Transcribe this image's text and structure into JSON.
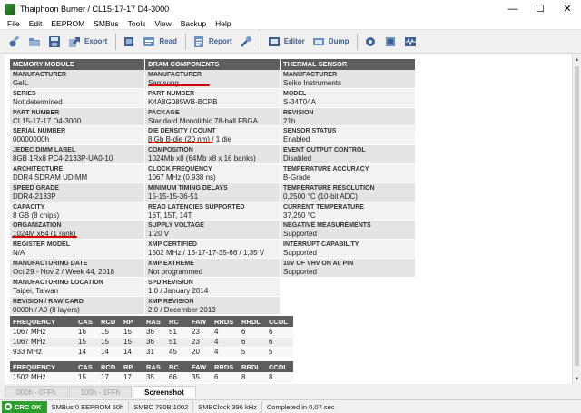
{
  "window": {
    "title": "Thaiphoon Burner / CL15-17-17 D4-3000",
    "controls": [
      "—",
      "☐",
      "✕"
    ]
  },
  "menu": [
    "File",
    "Edit",
    "EEPROM",
    "SMBus",
    "Tools",
    "View",
    "Backup",
    "Help"
  ],
  "toolbar": {
    "export_label": "Export",
    "read_label": "Read",
    "report_label": "Report",
    "editor_label": "Editor",
    "dump_label": "Dump"
  },
  "memory_module": {
    "header": "MEMORY MODULE",
    "rows": [
      {
        "label": "MANUFACTURER",
        "value": "GeIL"
      },
      {
        "label": "SERIES",
        "value": "Not determined"
      },
      {
        "label": "PART NUMBER",
        "value": "CL15-17-17 D4-3000"
      },
      {
        "label": "SERIAL NUMBER",
        "value": "00000000h"
      },
      {
        "label": "JEDEC DIMM LABEL",
        "value": "8GB 1Rx8 PC4-2133P-UA0-10"
      },
      {
        "label": "ARCHITECTURE",
        "value": "DDR4 SDRAM UDIMM"
      },
      {
        "label": "SPEED GRADE",
        "value": "DDR4-2133P"
      },
      {
        "label": "CAPACITY",
        "value": "8 GB (8 chips)"
      },
      {
        "label": "ORGANIZATION",
        "value": "1024M x64 (1 rank)"
      },
      {
        "label": "REGISTER MODEL",
        "value": "N/A"
      },
      {
        "label": "MANUFACTURING DATE",
        "value": "Oct 29 - Nov 2 / Week 44, 2018"
      },
      {
        "label": "MANUFACTURING LOCATION",
        "value": "Taipei, Taiwan"
      },
      {
        "label": "REVISION / RAW CARD",
        "value": "0000h / A0 (8 layers)"
      }
    ]
  },
  "dram_components": {
    "header": "DRAM COMPONENTS",
    "rows": [
      {
        "label": "MANUFACTURER",
        "value": "Samsung"
      },
      {
        "label": "PART NUMBER",
        "value": "K4A8G085WB-BCPB"
      },
      {
        "label": "PACKAGE",
        "value": "Standard Monolithic 78-ball FBGA"
      },
      {
        "label": "DIE DENSITY / COUNT",
        "value": "8 Gb B-die (20 nm) / 1 die"
      },
      {
        "label": "COMPOSITION",
        "value": "1024Mb x8 (64Mb x8 x 16 banks)"
      },
      {
        "label": "CLOCK FREQUENCY",
        "value": "1067 MHz (0.938 ns)"
      },
      {
        "label": "MINIMUM TIMING DELAYS",
        "value": "15-15-15-36-51"
      },
      {
        "label": "READ LATENCIES SUPPORTED",
        "value": "16T, 15T, 14T"
      },
      {
        "label": "SUPPLY VOLTAGE",
        "value": "1,20 V"
      },
      {
        "label": "XMP CERTIFIED",
        "value": "1502 MHz / 15-17-17-35-66 / 1,35 V"
      },
      {
        "label": "XMP EXTREME",
        "value": "Not programmed"
      },
      {
        "label": "SPD REVISION",
        "value": "1.0 / January 2014"
      },
      {
        "label": "XMP REVISION",
        "value": "2.0 / December 2013"
      }
    ]
  },
  "thermal_sensor": {
    "header": "THERMAL SENSOR",
    "rows": [
      {
        "label": "MANUFACTURER",
        "value": "Seiko Instruments"
      },
      {
        "label": "MODEL",
        "value": "S-34T04A"
      },
      {
        "label": "REVISION",
        "value": "21h"
      },
      {
        "label": "SENSOR STATUS",
        "value": "Enabled"
      },
      {
        "label": "EVENT OUTPUT CONTROL",
        "value": "Disabled"
      },
      {
        "label": "TEMPERATURE ACCURACY",
        "value": "B-Grade"
      },
      {
        "label": "TEMPERATURE RESOLUTION",
        "value": "0,2500 °C (10-bit ADC)"
      },
      {
        "label": "CURRENT TEMPERATURE",
        "value": "37,250 °C"
      },
      {
        "label": "NEGATIVE MEASUREMENTS",
        "value": "Supported"
      },
      {
        "label": "INTERRUPT CAPABILITY",
        "value": "Supported"
      },
      {
        "label": "10V OF VHV ON A0 PIN",
        "value": "Supported"
      }
    ]
  },
  "timing_table": {
    "headers": [
      "FREQUENCY",
      "CAS",
      "RCD",
      "RP",
      "RAS",
      "RC",
      "FAW",
      "RRDS",
      "RRDL",
      "CCDL"
    ],
    "rows": [
      [
        "1067 MHz",
        "16",
        "15",
        "15",
        "36",
        "51",
        "23",
        "4",
        "6",
        "6"
      ],
      [
        "1067 MHz",
        "15",
        "15",
        "15",
        "36",
        "51",
        "23",
        "4",
        "6",
        "6"
      ],
      [
        "933 MHz",
        "14",
        "14",
        "14",
        "31",
        "45",
        "20",
        "4",
        "5",
        "5"
      ]
    ]
  },
  "xmp_table": {
    "headers": [
      "FREQUENCY",
      "CAS",
      "RCD",
      "RP",
      "RAS",
      "RC",
      "FAW",
      "RRDS",
      "RRDL",
      "CCDL"
    ],
    "rows": [
      [
        "1502 MHz",
        "15",
        "17",
        "17",
        "35",
        "66",
        "35",
        "6",
        "8",
        "8"
      ]
    ]
  },
  "tabs": [
    "000h - 0FFh",
    "100h - 1FFh",
    "Screenshot"
  ],
  "status": {
    "crc": "CRC OK",
    "smbus": "SMBus 0 EEPROM 50h",
    "smbc": "SMBC 790B:1002",
    "clock": "SMBClock 396 kHz",
    "completed": "Completed in 0,07 sec"
  },
  "colors": {
    "header_bg": "#5d5d5d",
    "crc_ok": "#2e9e2e",
    "underline": "#d40000"
  }
}
